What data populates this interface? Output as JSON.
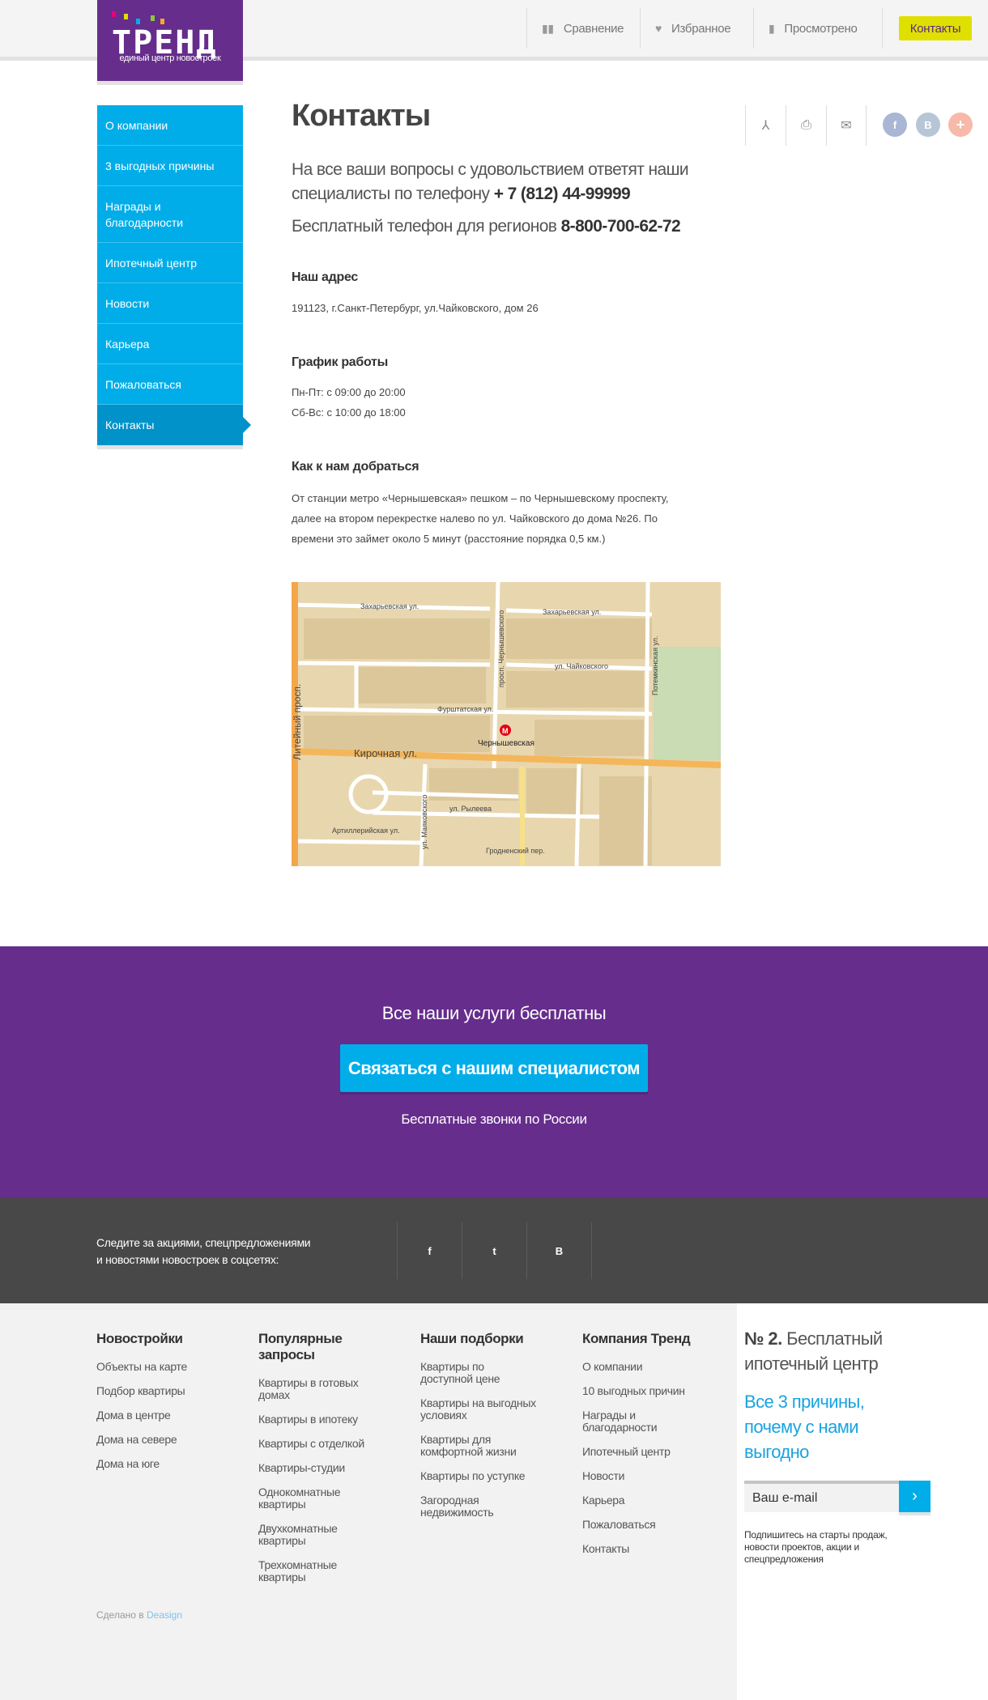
{
  "logo": {
    "word": "ТРЕНД",
    "tagline": "единый центр новостроек"
  },
  "header": {
    "nav": [
      {
        "label": "Сравнение",
        "icon": "bar-chart-icon"
      },
      {
        "label": "Избранное",
        "icon": "heart-icon"
      },
      {
        "label": "Просмотрено",
        "icon": "document-icon"
      }
    ],
    "contacts_button": "Контакты"
  },
  "sidebar": {
    "items": [
      {
        "label": "О компании"
      },
      {
        "label": "3 выгодных причины"
      },
      {
        "label": "Награды и благодарности"
      },
      {
        "label": "Ипотечный центр"
      },
      {
        "label": "Новости"
      },
      {
        "label": "Карьера"
      },
      {
        "label": "Пожаловаться"
      },
      {
        "label": "Контакты",
        "active": true
      }
    ]
  },
  "page": {
    "title": "Контакты",
    "lead1": "На все ваши вопросы с удовольствием ответят наши",
    "lead2": "специалисты по телефону",
    "phone": "+ 7 (812) 44-99999",
    "lead3": "Бесплатный телефон для регионов",
    "free_phone": "8-800-700-62-72",
    "address_title": "Наш адрес",
    "address": "191123, г.Санкт-Петербург, ул.Чайковского, дом 26",
    "hours_title": "График работы",
    "hours": [
      "Пн-Пт: с 09:00 до 20:00",
      "Сб-Вс: с 10:00 до 18:00"
    ],
    "directions_title": "Как к нам добраться",
    "directions": [
      "От станции метро «Чернышевская» пешком – по Чернышевскому проспекту,",
      "далее на втором перекрестке налево по ул. Чайковского до дома №26. По",
      "времени это займет около 5 минут (расстояние порядка 0,5 км.)"
    ]
  },
  "share": {
    "facebook": "f",
    "vk": "B",
    "plus": "+",
    "colors": {
      "facebook": "#a9b6d4",
      "vk": "#b6c6d6",
      "plus": "#f7b9a9"
    }
  },
  "map": {
    "labels": {
      "zakharievskaya": "Захарьевская ул.",
      "zakharievskaya2": "Захарьевская ул.",
      "chaikovskogo": "ул. Чайковского",
      "furshtatskaya": "Фурштатская ул.",
      "kirochnaya": "Кирочная ул.",
      "ryleeva": "ул. Рылеева",
      "artilleriyskaya": "Артиллерийская ул.",
      "grodnensky": "Гродненский пер.",
      "liteyny": "Литейный просп.",
      "chernyshevsky": "просп. Чернышевского",
      "mayakovskogo": "ул. Маяковского",
      "potemkinskaya": "Потемкинская ул.",
      "metro": "Чернышевская",
      "metro_symbol": "M"
    }
  },
  "promo": {
    "title": "Все наши услуги бесплатны",
    "button": "Связаться с нашим специалистом",
    "subtitle": "Бесплатные звонки по России"
  },
  "social_band": {
    "text1": "Следите за акциями, спецпредложениями",
    "text2": "и новостями новостроек в соцсетях:",
    "links": [
      "f",
      "t",
      "B"
    ]
  },
  "footer": {
    "columns": [
      {
        "title": "Новостройки",
        "items": [
          "Объекты на карте",
          "Подбор квартиры",
          "Дома в центре",
          "Дома на севере",
          "Дома на юге"
        ]
      },
      {
        "title": "Популярные запросы",
        "items": [
          "Квартиры в готовых домах",
          "Квартиры в ипотеку",
          "Квартиры с отделкой",
          "Квартиры-студии",
          "Однокомнатные квартиры",
          "Двухкомнатные квартиры",
          "Трехкомнатные квартиры"
        ]
      },
      {
        "title": "Наши подборки",
        "items": [
          "Квартиры по доступной цене",
          "Квартиры на выгодных условиях",
          "Квартиры для комфортной жизни",
          "Квартиры по уступке",
          "Загородная недвижимость"
        ]
      },
      {
        "title": "Компания Тренд",
        "items": [
          "О компании",
          "10 выгодных причин",
          "Награды и благодарности",
          "Ипотечный центр",
          "Новости",
          "Карьера",
          "Пожаловаться",
          "Контакты"
        ]
      }
    ],
    "made_in": "Сделано в",
    "made_link": "Deasign"
  },
  "right_panel": {
    "num": "№ 2.",
    "title_rest": "Бесплатный ипотечный центр",
    "link": "Все 3 причины, почему с нами выгодно",
    "email_placeholder": "Ваш e-mail",
    "submit": "›",
    "note": "Подпишитесь на старты продаж, новости проектов, акции и спецпредложения"
  }
}
